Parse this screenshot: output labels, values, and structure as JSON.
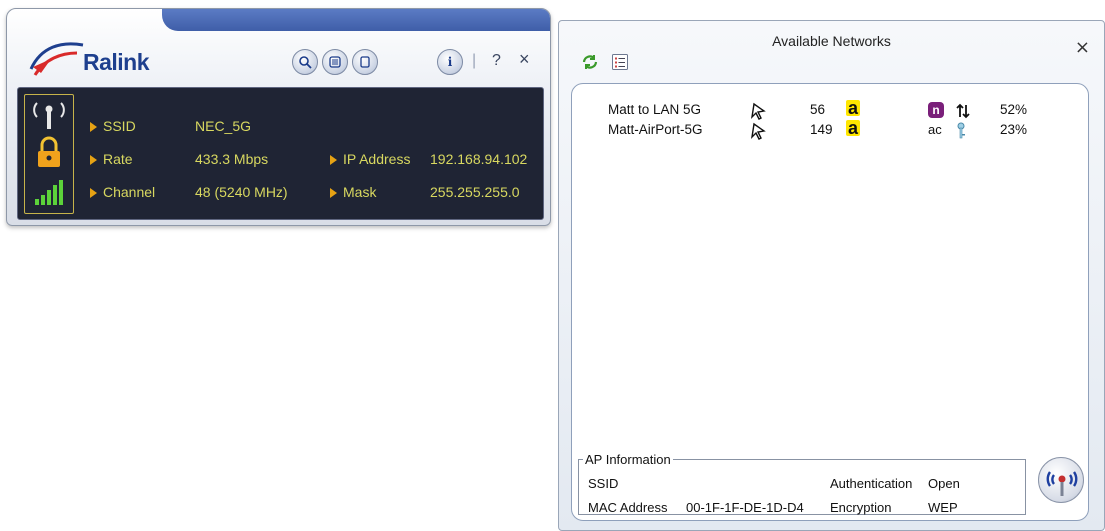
{
  "ralink": {
    "brand": "Ralink",
    "toolbar": {
      "help_label": "?",
      "close_label": "×",
      "separator": "|"
    },
    "status": {
      "ssid_label": "SSID",
      "ssid_value": "NEC_5G",
      "rate_label": "Rate",
      "rate_value": "433.3 Mbps",
      "channel_label": "Channel",
      "channel_value": "48 (5240 MHz)",
      "ip_label": "IP Address",
      "ip_value": "192.168.94.102",
      "mask_label": "Mask",
      "mask_value": "255.255.255.0"
    },
    "colors": {
      "panel_bg": "#1f2434",
      "label_text": "#d8d860",
      "bullet": "#e6a214",
      "brand_blue": "#1e3f8e"
    }
  },
  "networks_window": {
    "title": "Available Networks",
    "close_label": "×",
    "networks": [
      {
        "ssid": "Matt to LAN 5G",
        "channel": "56",
        "band_badge": "a",
        "phy_badge": "n",
        "extra_icon": "link-arrows-icon",
        "signal": "52%"
      },
      {
        "ssid": "Matt-AirPort-5G",
        "channel": "149",
        "band_badge": "a",
        "phy_badge": "ac",
        "extra_icon": "key-icon",
        "signal": "23%"
      }
    ],
    "ap_info": {
      "legend": "AP Information",
      "ssid_label": "SSID",
      "auth_label": "Authentication",
      "auth_value": "Open",
      "mac_label": "MAC Address",
      "mac_value": "00-1F-1F-DE-1D-D4",
      "encryption_label": "Encryption",
      "encryption_value": "WEP"
    }
  }
}
